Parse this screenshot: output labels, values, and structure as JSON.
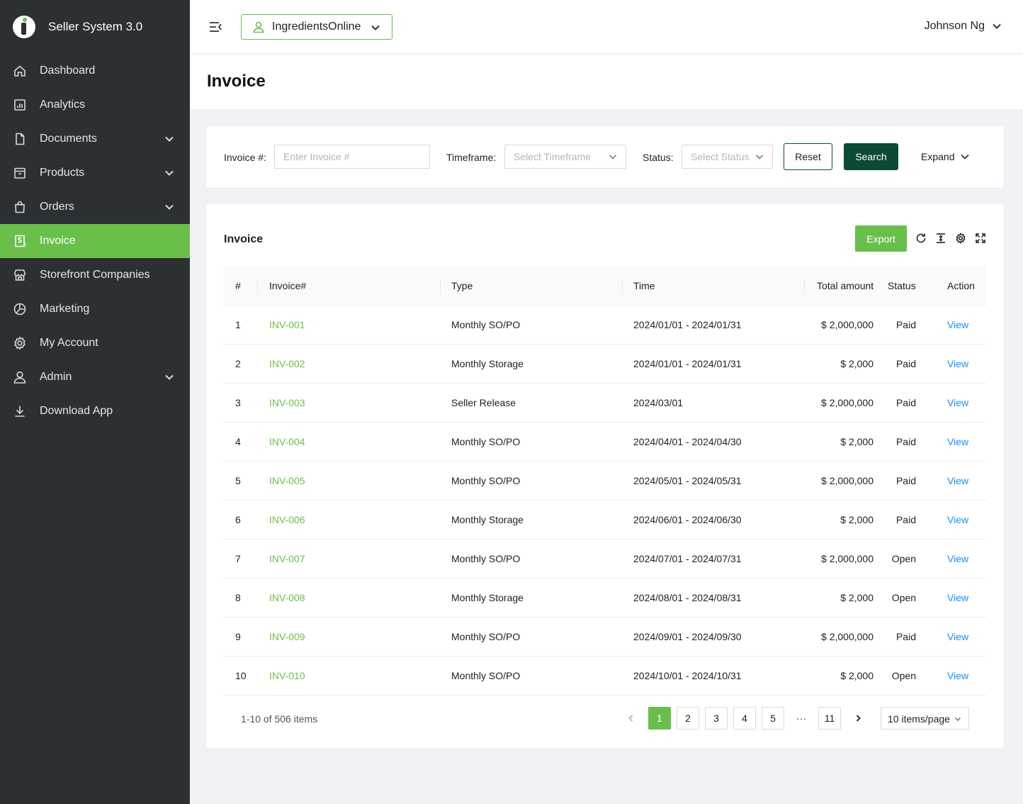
{
  "app": {
    "title": "Seller System 3.0"
  },
  "sidebar": {
    "items": [
      {
        "label": "Dashboard",
        "icon": "home-icon",
        "expandable": false,
        "active": false
      },
      {
        "label": "Analytics",
        "icon": "analytics-icon",
        "expandable": false,
        "active": false
      },
      {
        "label": "Documents",
        "icon": "document-icon",
        "expandable": true,
        "active": false
      },
      {
        "label": "Products",
        "icon": "box-icon",
        "expandable": true,
        "active": false
      },
      {
        "label": "Orders",
        "icon": "shopping-bag-icon",
        "expandable": true,
        "active": false
      },
      {
        "label": "Invoice",
        "icon": "invoice-icon",
        "expandable": false,
        "active": true
      },
      {
        "label": "Storefront Companies",
        "icon": "storefront-icon",
        "expandable": false,
        "active": false
      },
      {
        "label": "Marketing",
        "icon": "pie-chart-icon",
        "expandable": false,
        "active": false
      },
      {
        "label": "My Account",
        "icon": "gear-icon",
        "expandable": false,
        "active": false
      },
      {
        "label": "Admin",
        "icon": "user-icon",
        "expandable": true,
        "active": false
      },
      {
        "label": "Download App",
        "icon": "download-icon",
        "expandable": false,
        "active": false
      }
    ]
  },
  "header": {
    "store": "IngredientsOnline",
    "user": "Johnson Ng"
  },
  "page": {
    "title": "Invoice"
  },
  "filters": {
    "invoice_label": "Invoice #:",
    "invoice_placeholder": "Enter Invoice #",
    "timeframe_label": "Timeframe:",
    "timeframe_placeholder": "Select Timeframe",
    "status_label": "Status:",
    "status_placeholder": "Select Status",
    "reset": "Reset",
    "search": "Search",
    "expand": "Expand"
  },
  "table": {
    "title": "Invoice",
    "export": "Export",
    "columns": [
      "#",
      "Invoice#",
      "Type",
      "Time",
      "Total amount",
      "Status",
      "Action"
    ],
    "rows": [
      {
        "num": "1",
        "invoice": "INV-001",
        "type": "Monthly SO/PO",
        "time": "2024/01/01 - 2024/01/31",
        "amount": "$ 2,000,000",
        "status": "Paid",
        "action": "View"
      },
      {
        "num": "2",
        "invoice": "INV-002",
        "type": "Monthly Storage",
        "time": "2024/01/01 - 2024/01/31",
        "amount": "$ 2,000",
        "status": "Paid",
        "action": "View"
      },
      {
        "num": "3",
        "invoice": "INV-003",
        "type": "Seller Release",
        "time": "2024/03/01",
        "amount": "$ 2,000,000",
        "status": "Paid",
        "action": "View"
      },
      {
        "num": "4",
        "invoice": "INV-004",
        "type": "Monthly SO/PO",
        "time": "2024/04/01 - 2024/04/30",
        "amount": "$ 2,000",
        "status": "Paid",
        "action": "View"
      },
      {
        "num": "5",
        "invoice": "INV-005",
        "type": "Monthly SO/PO",
        "time": "2024/05/01 - 2024/05/31",
        "amount": "$ 2,000,000",
        "status": "Paid",
        "action": "View"
      },
      {
        "num": "6",
        "invoice": "INV-006",
        "type": "Monthly Storage",
        "time": "2024/06/01 - 2024/06/30",
        "amount": "$ 2,000",
        "status": "Paid",
        "action": "View"
      },
      {
        "num": "7",
        "invoice": "INV-007",
        "type": "Monthly SO/PO",
        "time": "2024/07/01 - 2024/07/31",
        "amount": "$ 2,000,000",
        "status": "Open",
        "action": "View"
      },
      {
        "num": "8",
        "invoice": "INV-008",
        "type": "Monthly Storage",
        "time": "2024/08/01 - 2024/08/31",
        "amount": "$ 2,000",
        "status": "Open",
        "action": "View"
      },
      {
        "num": "9",
        "invoice": "INV-009",
        "type": "Monthly SO/PO",
        "time": "2024/09/01 - 2024/09/30",
        "amount": "$ 2,000,000",
        "status": "Paid",
        "action": "View"
      },
      {
        "num": "10",
        "invoice": "INV-010",
        "type": "Monthly SO/PO",
        "time": "2024/10/01 - 2024/10/31",
        "amount": "$ 2,000",
        "status": "Open",
        "action": "View"
      }
    ]
  },
  "pagination": {
    "total_text": "1-10 of 506 items",
    "pages": [
      "1",
      "2",
      "3",
      "4",
      "5",
      "11"
    ],
    "current": "1",
    "ellipsis": "···",
    "page_size": "10 items/page"
  },
  "colors": {
    "accent_green": "#6abf4b",
    "dark_green": "#0b4a34",
    "sidebar_bg": "#2d3032",
    "link_blue": "#1890ff"
  }
}
